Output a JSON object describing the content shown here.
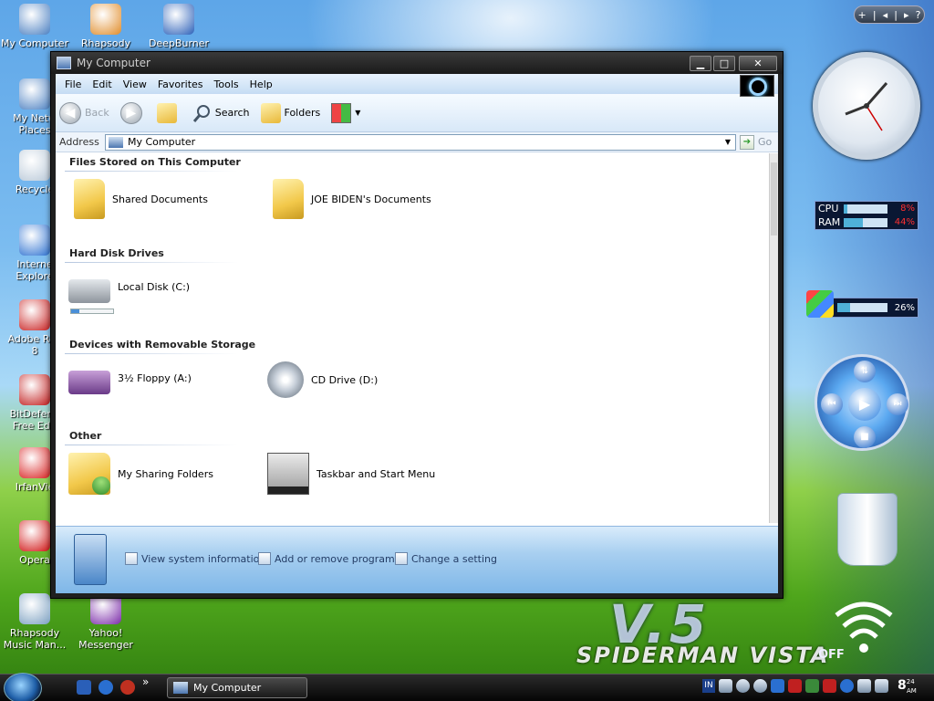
{
  "desktop": {
    "icons": [
      {
        "label": "My Computer",
        "color": "#4a7fc1"
      },
      {
        "label": "Rhapsody Play",
        "color": "#e08c2a"
      },
      {
        "label": "DeepBurner",
        "color": "#2a5fb8"
      },
      {
        "label": "My Netw",
        "label2": "Places",
        "color": "#4a7fc1"
      },
      {
        "label": "Recycle",
        "color": "#b8c8d8"
      },
      {
        "label": "Interne",
        "label2": "Explore",
        "color": "#2a6fd0"
      },
      {
        "label": "Adobe Rea",
        "label2": "8",
        "color": "#c81e1e"
      },
      {
        "label": "BitDefend",
        "label2": "Free Edit",
        "color": "#c01818"
      },
      {
        "label": "IrfanVie",
        "color": "#d81e1e"
      },
      {
        "label": "Opera",
        "color": "#d01010"
      },
      {
        "label": "Rhapsody",
        "label2": "Music Man...",
        "color": "#7a9fc0"
      },
      {
        "label": "Yahoo!",
        "label2": "Messenger",
        "color": "#7a2aa8"
      }
    ],
    "branding_small": "SPIDERMAN VISTA",
    "branding_big": "V.5",
    "wifi_state": "OFF"
  },
  "gadgets": {
    "nav": [
      "+",
      "|",
      "◂",
      "|",
      "▸",
      "?"
    ],
    "cpu_label": "CPU",
    "cpu_value": "8%",
    "cpu_fraction": 0.08,
    "ram_label": "RAM",
    "ram_value": "44%",
    "ram_fraction": 0.44,
    "disk_value": "26%",
    "disk_fraction": 0.26
  },
  "window": {
    "title": "My Computer",
    "minimize": "▁",
    "maximize": "□",
    "close": "✕",
    "menu": [
      "File",
      "Edit",
      "View",
      "Favorites",
      "Tools",
      "Help"
    ],
    "toolbar": {
      "back": "Back",
      "search": "Search",
      "folders": "Folders"
    },
    "address": {
      "label": "Address",
      "value": "My Computer",
      "go": "Go"
    },
    "groups": {
      "files": "Files Stored on This Computer",
      "drives": "Hard Disk Drives",
      "removable": "Devices with Removable Storage",
      "other": "Other"
    },
    "items": {
      "shared_docs": "Shared Documents",
      "user_docs": "JOE BIDEN's Documents",
      "local_disk": "Local Disk (C:)",
      "local_disk_used_fraction": 0.2,
      "floppy": "3½ Floppy (A:)",
      "cd": "CD Drive (D:)",
      "sharing": "My Sharing Folders",
      "taskbar": "Taskbar and Start Menu"
    },
    "footer_links": [
      "View system information",
      "Add or remove programs",
      "Change a setting"
    ]
  },
  "taskbar": {
    "task": "My Computer",
    "chevron": "»",
    "lang": "IN",
    "time_hour": "8",
    "time_minutes": "24",
    "time_ampm": "AM"
  }
}
